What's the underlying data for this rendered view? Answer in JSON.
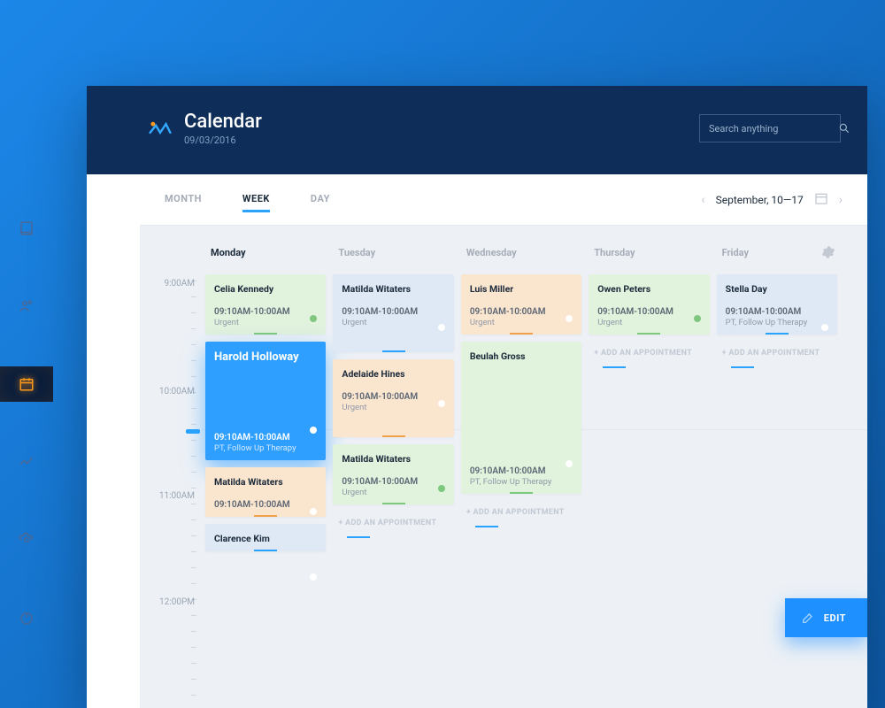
{
  "header": {
    "title": "Calendar",
    "date": "09/03/2016",
    "search_placeholder": "Search anything"
  },
  "tabs": {
    "month": "MONTH",
    "week": "WEEK",
    "day": "DAY"
  },
  "date_nav": {
    "range": "September, 10—17"
  },
  "time_labels": [
    "9:00AM",
    "10:00AM",
    "11:00AM",
    "12:00PM"
  ],
  "days": [
    "Monday",
    "Tuesday",
    "Wednesday",
    "Thursday",
    "Friday"
  ],
  "add_label": "+ ADD AN APPOINTMENT",
  "edit_label": "EDIT",
  "events": {
    "mon": [
      {
        "name": "Celia Kennedy",
        "time": "09:10AM-10:00AM",
        "note": "Urgent",
        "style": "green"
      },
      {
        "name": "Harold Holloway",
        "time": "09:10AM-10:00AM",
        "note": "PT, Follow Up Therapy",
        "style": "sel"
      },
      {
        "name": "Matilda Witaters",
        "time": "09:10AM-10:00AM",
        "note": "",
        "style": "orange"
      },
      {
        "name": "Clarence Kim",
        "time": "",
        "note": "",
        "style": "blue"
      }
    ],
    "tue": [
      {
        "name": "Matilda Witaters",
        "time": "09:10AM-10:00AM",
        "note": "Urgent",
        "style": "blue",
        "tall": true
      },
      {
        "name": "Adelaide Hines",
        "time": "09:10AM-10:00AM",
        "note": "Urgent",
        "style": "orange",
        "tall": true
      },
      {
        "name": "Matilda Witaters",
        "time": "09:10AM-10:00AM",
        "note": "Urgent",
        "style": "green"
      }
    ],
    "wed": [
      {
        "name": "Luis Miller",
        "time": "09:10AM-10:00AM",
        "note": "Urgent",
        "style": "orange"
      },
      {
        "name": "Beulah Gross",
        "time": "09:10AM-10:00AM",
        "note": "PT, Follow Up Therapy",
        "style": "greenL"
      }
    ],
    "thu": [
      {
        "name": "Owen Peters",
        "time": "09:10AM-10:00AM",
        "note": "Urgent",
        "style": "green"
      }
    ],
    "fri": [
      {
        "name": "Stella Day",
        "time": "09:10AM-10:00AM",
        "note": "PT, Follow Up Therapy",
        "style": "blue"
      }
    ]
  }
}
